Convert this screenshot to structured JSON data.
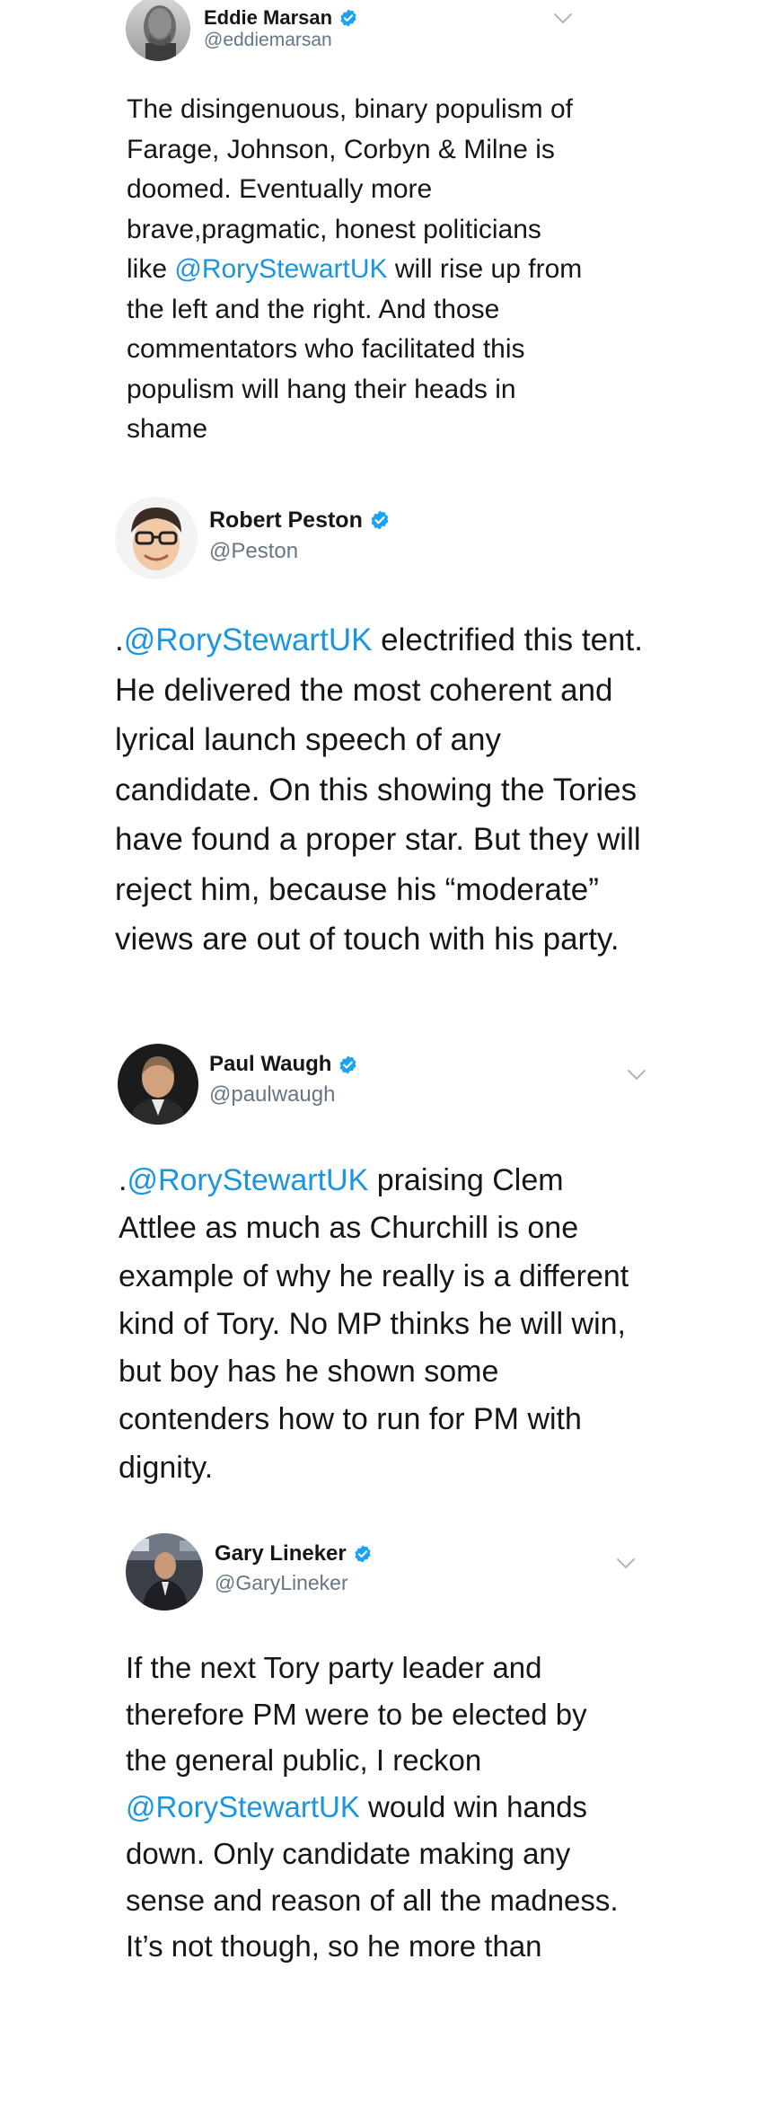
{
  "colors": {
    "text": "#14171a",
    "secondary": "#657786",
    "link": "#1b95e0",
    "verified": "#1da1f2",
    "chevron": "#aab8c2"
  },
  "tweets": [
    {
      "name": "Eddie Marsan",
      "handle": "@eddiemarsan",
      "verified": true,
      "avatar_icon": "avatar-photo",
      "menu_icon": "chevron-down-icon",
      "lines": [
        {
          "text": "The disingenuous, binary populism of"
        },
        {
          "text": "Farage, Johnson, Corbyn & Milne is"
        },
        {
          "text": "doomed. Eventually more"
        },
        {
          "text": "brave,pragmatic, honest politicians"
        },
        {
          "pre": "like ",
          "mention": "@RoryStewartUK",
          "post": " will rise up from"
        },
        {
          "text": "the left and the right.  And those"
        },
        {
          "text": "commentators who facilitated this"
        },
        {
          "text": "populism will hang their heads in"
        },
        {
          "text": "shame"
        }
      ]
    },
    {
      "name": "Robert Peston",
      "handle": "@Peston",
      "verified": true,
      "avatar_icon": "avatar-cartoon",
      "lines": [
        {
          "pre": ".",
          "mention": "@RoryStewartUK",
          "post": " electrified this tent."
        },
        {
          "text": "He delivered the most coherent and"
        },
        {
          "text": "lyrical launch speech of any"
        },
        {
          "text": "candidate. On this showing the Tories"
        },
        {
          "text": "have found a proper star. But they will"
        },
        {
          "text": "reject him, because his “moderate”"
        },
        {
          "text": "views are out of touch with his party."
        }
      ]
    },
    {
      "name": "Paul Waugh",
      "handle": "@paulwaugh",
      "verified": true,
      "avatar_icon": "avatar-photo",
      "menu_icon": "chevron-down-icon",
      "lines": [
        {
          "pre": ".",
          "mention": "@RoryStewartUK",
          "post": " praising Clem"
        },
        {
          "text": "Attlee as much as Churchill is one"
        },
        {
          "text": "example of why he really is a different"
        },
        {
          "text": "kind of Tory. No MP thinks he will win,"
        },
        {
          "text": "but boy has he shown some"
        },
        {
          "text": "contenders how to run for PM with"
        },
        {
          "text": "dignity."
        }
      ]
    },
    {
      "name": "Gary Lineker",
      "handle": "@GaryLineker",
      "verified": true,
      "avatar_icon": "avatar-photo",
      "menu_icon": "chevron-down-icon",
      "lines": [
        {
          "text": "If the next Tory party leader and"
        },
        {
          "text": "therefore PM were to be elected by"
        },
        {
          "text": "the general public, I reckon"
        },
        {
          "pre": "",
          "mention": "@RoryStewartUK",
          "post": " would win hands"
        },
        {
          "text": "down. Only candidate making any"
        },
        {
          "text": "sense and reason of all the madness."
        },
        {
          "text": "It’s not though, so he more than"
        }
      ]
    }
  ]
}
